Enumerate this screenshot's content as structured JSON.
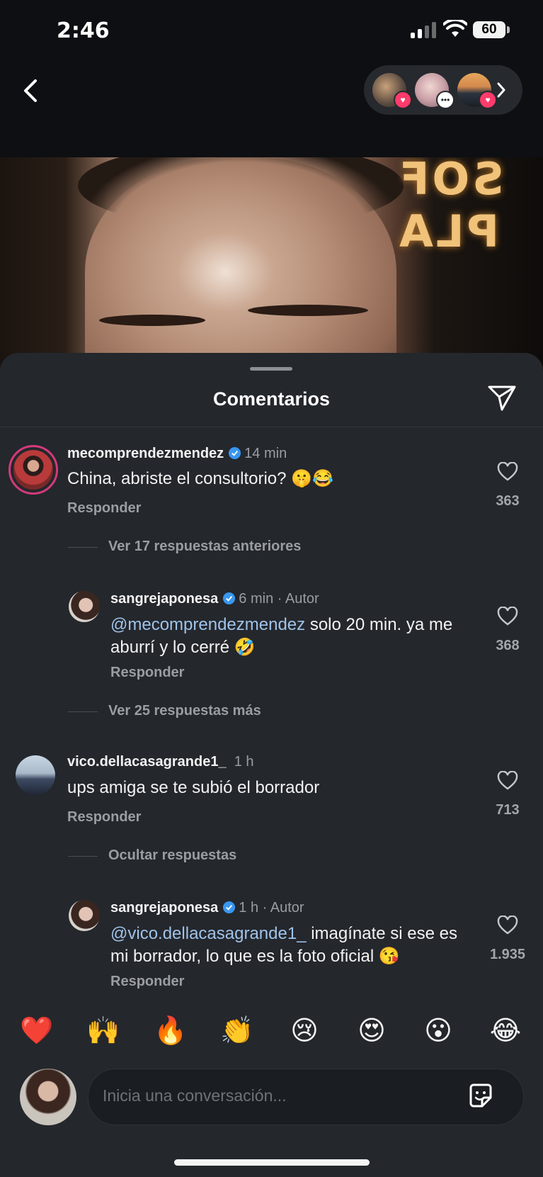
{
  "status_bar": {
    "time": "2:46",
    "battery": "60"
  },
  "sheet": {
    "title": "Comentarios"
  },
  "comments": [
    {
      "username": "mecomprendezmendez",
      "time": "14 min",
      "text": "China, abriste el consultorio? 🤫😂",
      "reply": "Responder",
      "likes": "363"
    },
    {
      "username": "vico.dellacasagrande1_",
      "time": "1 h",
      "text": "ups amiga se te subió el borrador",
      "reply": "Responder",
      "likes": "713"
    }
  ],
  "replies": [
    {
      "username": "sangrejaponesa",
      "meta": "6 min · Autor",
      "mention": "@mecomprendezmendez",
      "text": " solo 20 min. ya me aburrí y lo cerré 🤣",
      "reply": "Responder",
      "likes": "368"
    },
    {
      "username": "sangrejaponesa",
      "meta": "1 h · Autor",
      "mention": "@vico.dellacasagrande1_",
      "text": " imagínate si ese es mi borrador, lo que es la foto oficial 😘",
      "reply": "Responder",
      "likes": "1.935"
    }
  ],
  "thread_links": {
    "previous": "Ver 17 respuestas anteriores",
    "more": "Ver 25 respuestas más",
    "hide": "Ocultar respuestas"
  },
  "emoji_bar": [
    "❤️",
    "🙌",
    "🔥",
    "👏",
    "😢",
    "😍",
    "😮",
    "😂"
  ],
  "input": {
    "placeholder": "Inicia una conversación..."
  },
  "colors": {
    "sheet_bg": "#24272c",
    "mention": "#9fc3ea",
    "verified": "#3897f0"
  }
}
